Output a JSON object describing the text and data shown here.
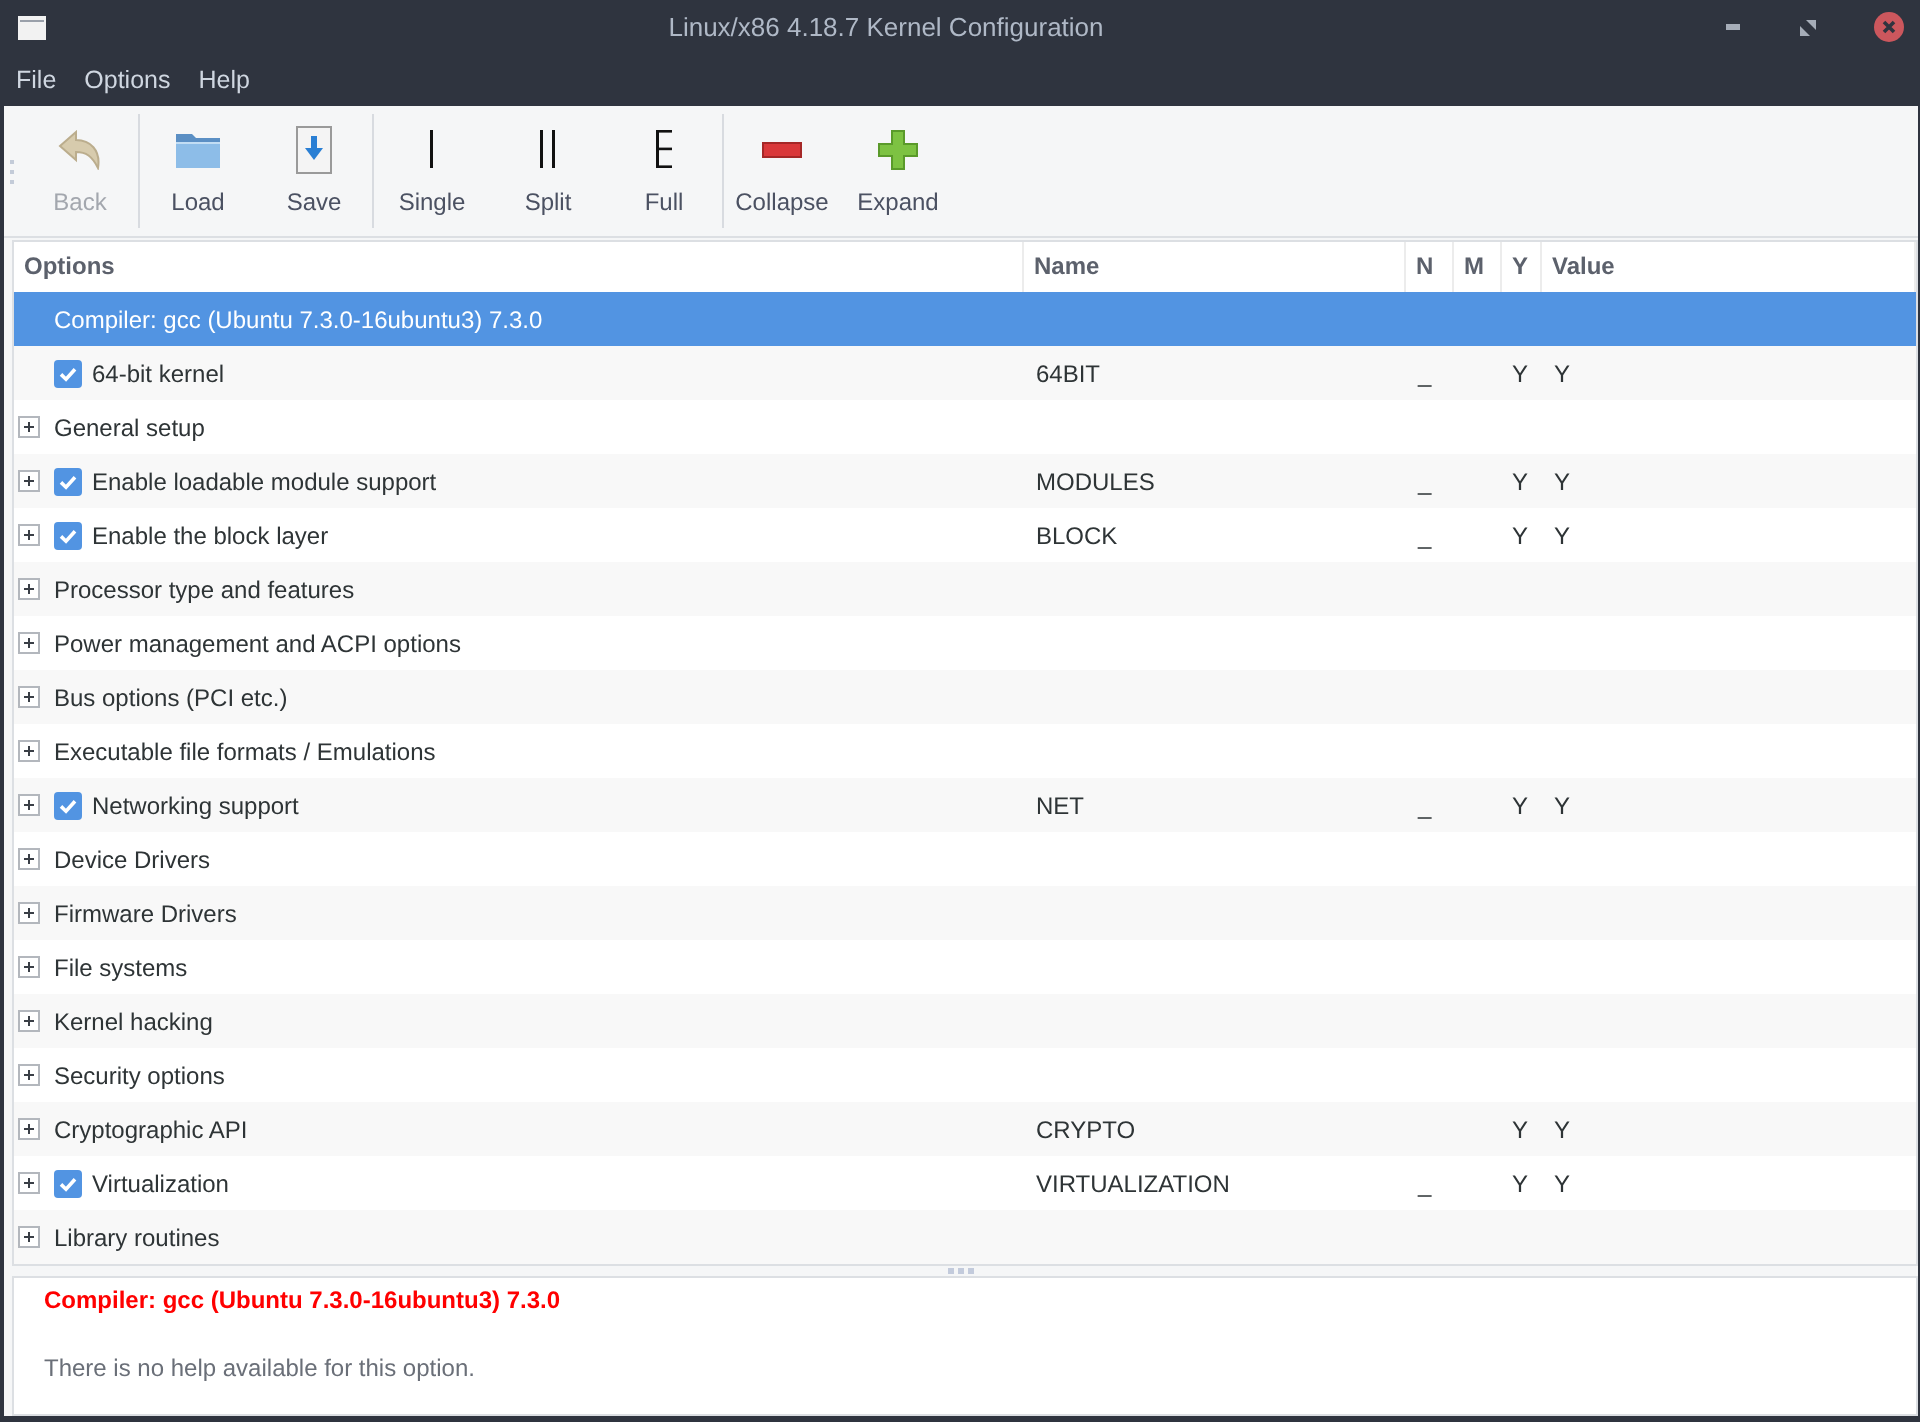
{
  "window": {
    "title": "Linux/x86 4.18.7 Kernel Configuration"
  },
  "menu": [
    "File",
    "Options",
    "Help"
  ],
  "toolbar": [
    {
      "buttons": [
        {
          "kind": "back",
          "label": "Back",
          "disabled": true
        }
      ]
    },
    {
      "buttons": [
        {
          "kind": "load",
          "label": "Load",
          "disabled": false
        },
        {
          "kind": "save",
          "label": "Save",
          "disabled": false
        }
      ]
    },
    {
      "buttons": [
        {
          "kind": "single",
          "label": "Single",
          "disabled": false
        },
        {
          "kind": "split",
          "label": "Split",
          "disabled": false
        },
        {
          "kind": "full",
          "label": "Full",
          "disabled": false
        }
      ]
    },
    {
      "buttons": [
        {
          "kind": "collapse",
          "label": "Collapse",
          "disabled": false
        },
        {
          "kind": "expand",
          "label": "Expand",
          "disabled": false
        }
      ]
    }
  ],
  "tree": {
    "columns": [
      "Options",
      "Name",
      "N",
      "M",
      "Y",
      "Value"
    ],
    "rows": [
      {
        "kind": "comment",
        "option": "Compiler: gcc (Ubuntu 7.3.0-16ubuntu3) 7.3.0",
        "selected": true
      },
      {
        "kind": "check",
        "option": "64-bit kernel",
        "checked": true,
        "name": "64BIT",
        "n": "_",
        "y": "Y",
        "value": "Y",
        "selected": false
      },
      {
        "kind": "menu",
        "option": "General setup",
        "expanded": false,
        "selected": false
      },
      {
        "kind": "menu-check",
        "option": "Enable loadable module support",
        "expanded": false,
        "checked": true,
        "name": "MODULES",
        "n": "_",
        "y": "Y",
        "value": "Y",
        "selected": false
      },
      {
        "kind": "menu-check",
        "option": "Enable the block layer",
        "expanded": false,
        "checked": true,
        "name": "BLOCK",
        "n": "_",
        "y": "Y",
        "value": "Y",
        "selected": false
      },
      {
        "kind": "menu",
        "option": "Processor type and features",
        "expanded": false,
        "selected": false
      },
      {
        "kind": "menu",
        "option": "Power management and ACPI options",
        "expanded": false,
        "selected": false
      },
      {
        "kind": "menu",
        "option": "Bus options (PCI etc.)",
        "expanded": false,
        "selected": false
      },
      {
        "kind": "menu",
        "option": "Executable file formats / Emulations",
        "expanded": false,
        "selected": false
      },
      {
        "kind": "menu-check",
        "option": "Networking support",
        "expanded": false,
        "checked": true,
        "name": "NET",
        "n": "_",
        "y": "Y",
        "value": "Y",
        "selected": false
      },
      {
        "kind": "menu",
        "option": "Device Drivers",
        "expanded": false,
        "selected": false
      },
      {
        "kind": "menu",
        "option": "Firmware Drivers",
        "expanded": false,
        "selected": false
      },
      {
        "kind": "menu",
        "option": "File systems",
        "expanded": false,
        "selected": false
      },
      {
        "kind": "menu",
        "option": "Kernel hacking",
        "expanded": false,
        "selected": false
      },
      {
        "kind": "menu",
        "option": "Security options",
        "expanded": false,
        "selected": false
      },
      {
        "kind": "menu",
        "option": "Cryptographic API",
        "expanded": false,
        "name": "CRYPTO",
        "y": "Y",
        "value": "Y",
        "selected": false
      },
      {
        "kind": "menu-check",
        "option": "Virtualization",
        "expanded": false,
        "checked": true,
        "name": "VIRTUALIZATION",
        "n": "_",
        "y": "Y",
        "value": "Y",
        "selected": false
      },
      {
        "kind": "menu",
        "option": "Library routines",
        "expanded": false,
        "selected": false
      }
    ]
  },
  "help": {
    "title": "Compiler: gcc (Ubuntu 7.3.0-16ubuntu3) 7.3.0",
    "text": "There is no help available for this option."
  }
}
